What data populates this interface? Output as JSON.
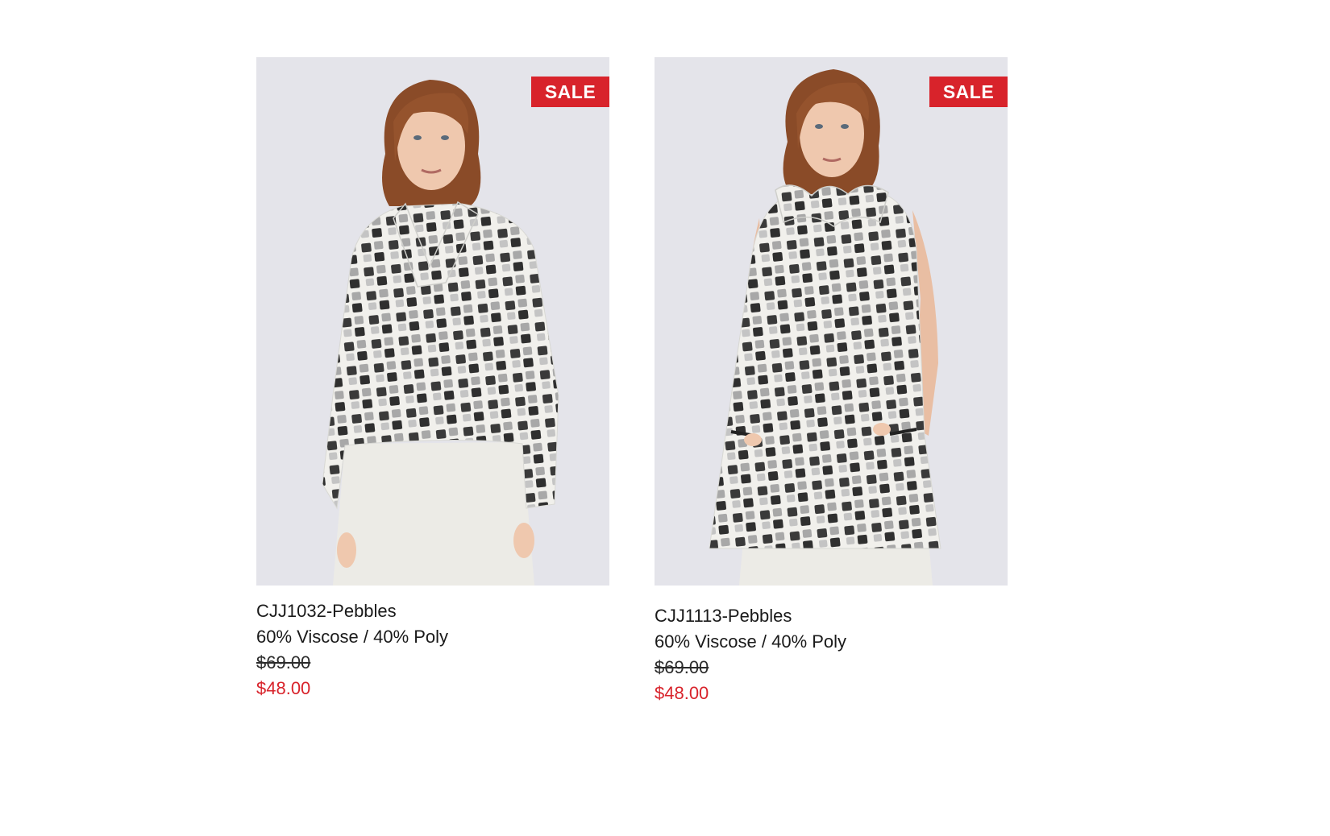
{
  "colors": {
    "sale_red": "#d8232b",
    "photo_background": "#e4e4ea",
    "text": "#1a1a1a"
  },
  "products": [
    {
      "badge": "SALE",
      "name": "CJJ1032-Pebbles",
      "material": "60% Viscose / 40% Poly",
      "original_price": "$69.00",
      "sale_price": "$48.00",
      "garment": "jacket"
    },
    {
      "badge": "SALE",
      "name": "CJJ1113-Pebbles",
      "material": "60% Viscose / 40% Poly",
      "original_price": "$69.00",
      "sale_price": "$48.00",
      "garment": "vest"
    }
  ]
}
